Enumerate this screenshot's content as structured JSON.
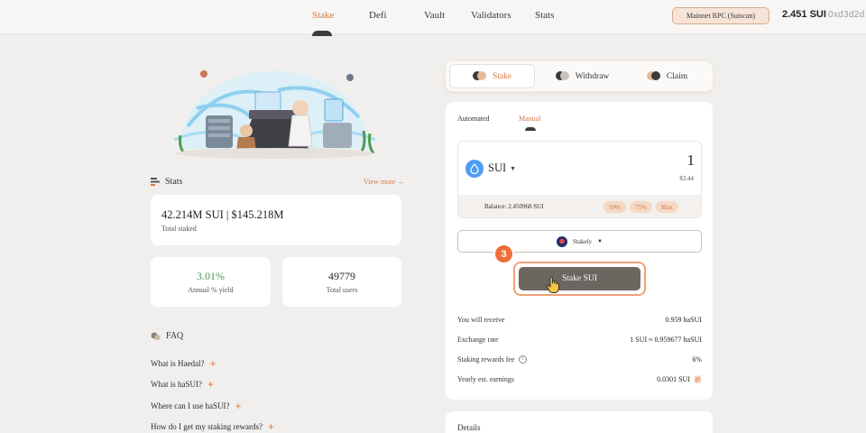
{
  "nav": {
    "items": [
      "Stake",
      "Defi",
      "Vault",
      "Validators",
      "Stats"
    ],
    "active": "Stake",
    "rpc_label": "Mainnet RPC (Suiscan)",
    "wallet_balance": "2.451 SUI",
    "wallet_address": "0xd3d2d…"
  },
  "stats": {
    "title": "Stats",
    "view_more": "View more →",
    "total_staked_value": "42.214M SUI | $145.218M",
    "total_staked_label": "Total staked",
    "apy_value": "3.01%",
    "apy_label": "Annual % yield",
    "users_value": "49779",
    "users_label": "Total users"
  },
  "faq": {
    "title": "FAQ",
    "items": [
      "What is Haedal?",
      "What is haSUI?",
      "Where can I use haSUI?",
      "How do I get my staking rewards?"
    ]
  },
  "mode_tabs": {
    "stake": "Stake",
    "withdraw": "Withdraw",
    "claim": "Claim",
    "active": "Stake"
  },
  "stake_panel": {
    "subtabs": {
      "automated": "Automated",
      "manual": "Manual",
      "active": "Manual"
    },
    "token": "SUI",
    "amount": "1",
    "usd_value": "$3.44",
    "balance_text": "Balance: 2.450968 SUI",
    "chips": [
      "50%",
      "75%",
      "Max"
    ],
    "validator": "Stakely",
    "step_badge": "3",
    "stake_button": "Stake SUI",
    "info": {
      "receive_label": "You will receive",
      "receive_value": "0.959 haSUI",
      "rate_label": "Exchange rate",
      "rate_value": "1 SUI ≈ 0.959677 haSUI",
      "fee_label": "Staking rewards fee",
      "fee_value": "6%",
      "earnings_label": "Yearly est. earnings",
      "earnings_value": "0.0301 SUI"
    }
  },
  "details": {
    "title": "Details"
  },
  "icons": {
    "token": "sui-drop-icon",
    "hand": "hand-cursor-icon",
    "stats": "stats-bars-icon",
    "faq": "faq-chat-icon"
  },
  "colors": {
    "accent": "#d9793f",
    "badge": "#ee6e3a",
    "button": "#6b6660",
    "apy_green": "#4a9a4f",
    "sui_blue": "#4d9cf5"
  }
}
